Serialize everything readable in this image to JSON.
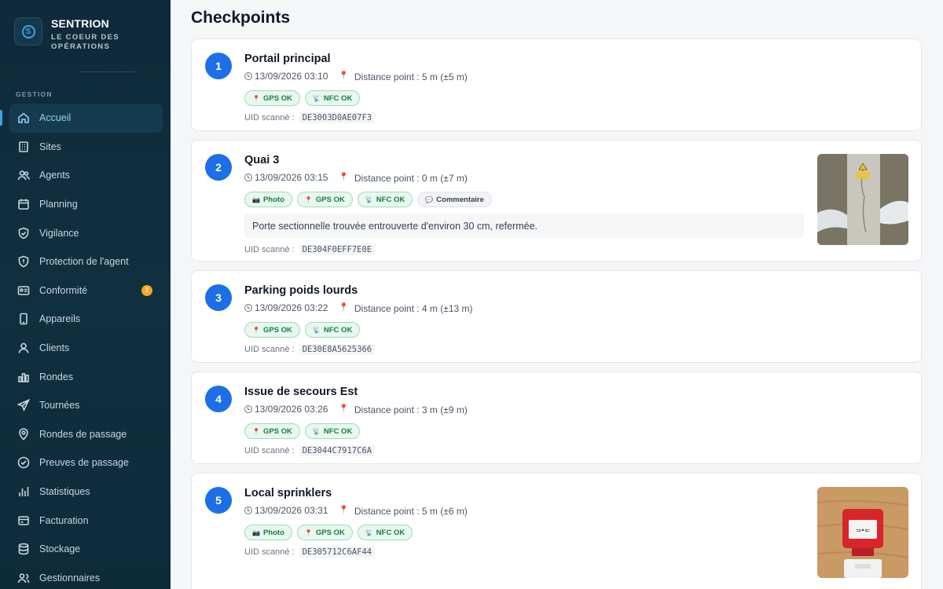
{
  "brand": {
    "name": "SENTRION",
    "tagline": "LE COEUR DES OPÉRATIONS"
  },
  "sidebar": {
    "section": "GESTION",
    "items": [
      {
        "label": "Accueil",
        "icon": "home-icon",
        "active": true
      },
      {
        "label": "Sites",
        "icon": "building-icon"
      },
      {
        "label": "Agents",
        "icon": "users-icon"
      },
      {
        "label": "Planning",
        "icon": "calendar-icon"
      },
      {
        "label": "Vigilance",
        "icon": "shield-check-icon"
      },
      {
        "label": "Protection de l'agent",
        "icon": "shield-icon"
      },
      {
        "label": "Conformité",
        "icon": "id-card-icon",
        "badge": "1"
      },
      {
        "label": "Appareils",
        "icon": "phone-icon"
      },
      {
        "label": "Clients",
        "icon": "contact-icon"
      },
      {
        "label": "Rondes",
        "icon": "bar-chart-icon"
      },
      {
        "label": "Tournées",
        "icon": "send-icon"
      },
      {
        "label": "Rondes de passage",
        "icon": "map-pin-icon"
      },
      {
        "label": "Preuves de passage",
        "icon": "check-circle-icon"
      },
      {
        "label": "Statistiques",
        "icon": "stats-icon"
      },
      {
        "label": "Facturation",
        "icon": "invoice-icon"
      },
      {
        "label": "Stockage",
        "icon": "database-icon"
      },
      {
        "label": "Gestionnaires",
        "icon": "managers-icon"
      }
    ]
  },
  "main": {
    "title": "Checkpoints",
    "uid_label": "UID scanné :",
    "checkpoints": [
      {
        "number": "1",
        "title": "Portail principal",
        "time": "13/09/2026 03:10",
        "distance": "Distance point : 5 m (±5 m)",
        "tags": [
          "GPS OK",
          "NFC OK"
        ],
        "uid": "DE3003D0AE07F3"
      },
      {
        "number": "2",
        "title": "Quai 3",
        "time": "13/09/2026 03:15",
        "distance": "Distance point : 0 m (±7 m)",
        "tags": [
          "Photo",
          "GPS OK",
          "NFC OK",
          "Commentaire"
        ],
        "comment": "Porte sectionnelle trouvée entrouverte d'environ 30 cm, refermée.",
        "uid": "DE304F0EFF7E0E"
      },
      {
        "number": "3",
        "title": "Parking poids lourds",
        "time": "13/09/2026 03:22",
        "distance": "Distance point : 4 m (±13 m)",
        "tags": [
          "GPS OK",
          "NFC OK"
        ],
        "uid": "DE30E8A5625366"
      },
      {
        "number": "4",
        "title": "Issue de secours Est",
        "time": "13/09/2026 03:26",
        "distance": "Distance point : 3 m (±9 m)",
        "tags": [
          "GPS OK",
          "NFC OK"
        ],
        "uid": "DE3044C7917C6A"
      },
      {
        "number": "5",
        "title": "Local sprinklers",
        "time": "13/09/2026 03:31",
        "distance": "Distance point : 5 m (±6 m)",
        "tags": [
          "Photo",
          "GPS OK",
          "NFC OK"
        ],
        "uid": "DE305712C6AF44"
      }
    ]
  },
  "colors": {
    "accent": "#1d6fe8",
    "sidebar_bg": "#0f2a3a",
    "ok_green": "#13803f",
    "badge_orange": "#f5a623"
  }
}
